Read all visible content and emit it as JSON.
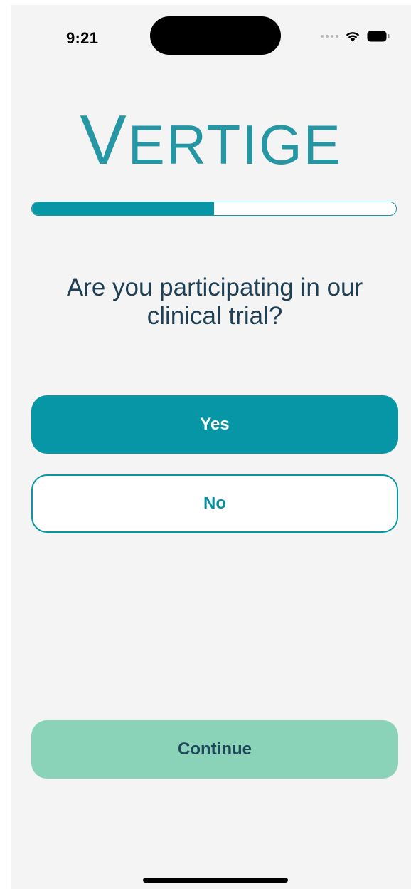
{
  "status_bar": {
    "time": "9:21"
  },
  "logo": {
    "first_letter": "V",
    "rest": "ERTIGE"
  },
  "progress": {
    "fraction": 0.5
  },
  "question": {
    "text": "Are you participating in our clinical trial?"
  },
  "options": {
    "yes_label": "Yes",
    "no_label": "No"
  },
  "footer": {
    "continue_label": "Continue"
  },
  "colors": {
    "brand_teal": "#0796a6",
    "continue_mint": "#8bd3b8",
    "text_dark": "#1f3f55",
    "background": "#f4f4f4"
  }
}
